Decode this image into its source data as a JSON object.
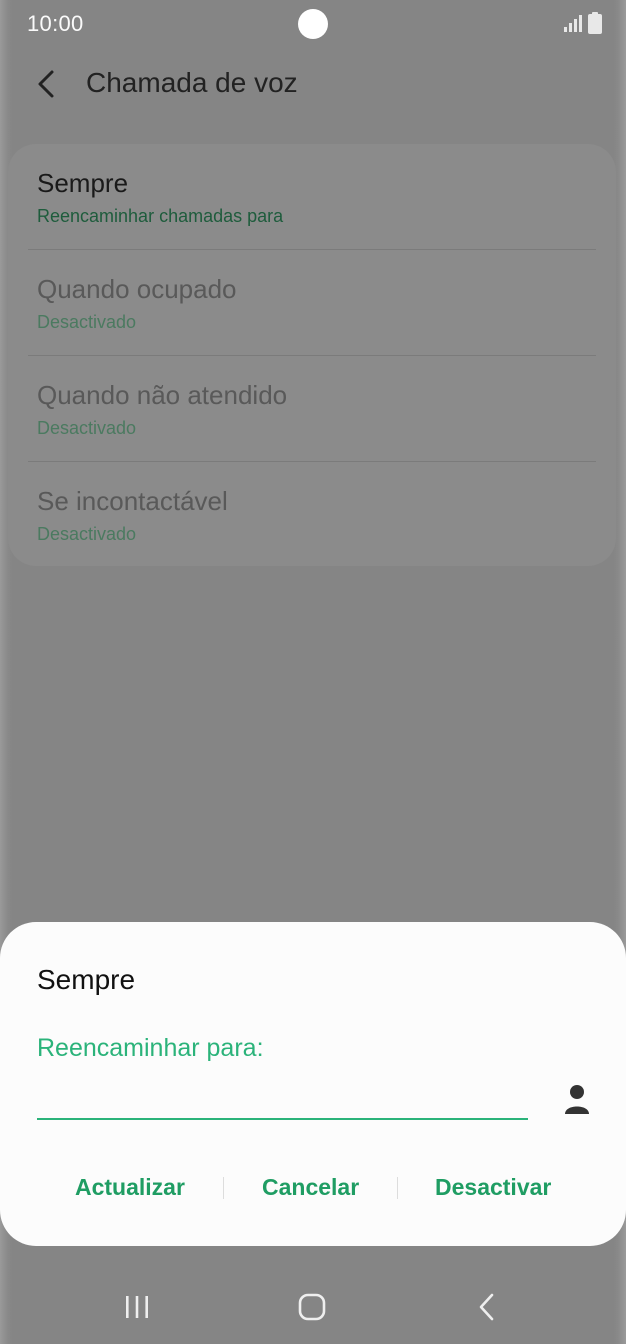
{
  "status_bar": {
    "time": "10:00",
    "icons": [
      "camera-dot",
      "signal-icon",
      "battery-icon"
    ]
  },
  "app_bar": {
    "back_icon": "chevron-left-icon",
    "title": "Chamada de voz"
  },
  "forwarding_options": [
    {
      "title": "Sempre",
      "subtitle": "Reencaminhar chamadas para",
      "enabled": true
    },
    {
      "title": "Quando ocupado",
      "subtitle": "Desactivado",
      "enabled": false
    },
    {
      "title": "Quando não atendido",
      "subtitle": "Desactivado",
      "enabled": false
    },
    {
      "title": "Se incontactável",
      "subtitle": "Desactivado",
      "enabled": false
    }
  ],
  "dialog": {
    "title": "Sempre",
    "field_label": "Reencaminhar para:",
    "field_value": "",
    "contact_icon": "person-icon",
    "buttons": {
      "update": "Actualizar",
      "cancel": "Cancelar",
      "disable": "Desactivar"
    }
  },
  "nav_bar": {
    "items": [
      "recents-icon",
      "home-icon",
      "back-icon"
    ]
  },
  "colors": {
    "accent": "#2bb37a",
    "button_text": "#1f9d63",
    "dim_overlay": "#858585"
  }
}
